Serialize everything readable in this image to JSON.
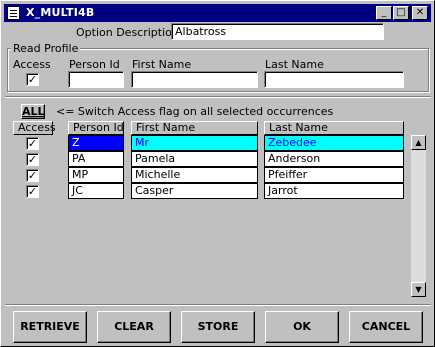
{
  "window": {
    "title": "X_MULTI4B",
    "minimize_glyph": "_",
    "maximize_glyph": "□",
    "close_glyph": "✕"
  },
  "option": {
    "label": "Option Description",
    "value": "Albatross"
  },
  "read_profile": {
    "legend": "Read Profile",
    "access_label": "Access",
    "person_id_label": "Person Id",
    "first_name_label": "First Name",
    "last_name_label": "Last Name",
    "access_checked": true,
    "person_id": "",
    "first_name": "",
    "last_name": ""
  },
  "switch": {
    "all_button": "ALL",
    "hint": "<= Switch Access flag on all selected occurrences"
  },
  "grid": {
    "headers": {
      "access": "Access",
      "person_id": "Person Id",
      "first_name": "First Name",
      "last_name": "Last Name"
    },
    "rows": [
      {
        "access": true,
        "person_id": "Z",
        "first_name": "Mr",
        "last_name": "Zebedee",
        "selected": true
      },
      {
        "access": true,
        "person_id": "PA",
        "first_name": "Pamela",
        "last_name": "Anderson",
        "selected": false
      },
      {
        "access": true,
        "person_id": "MP",
        "first_name": "Michelle",
        "last_name": "Pfeiffer",
        "selected": false
      },
      {
        "access": true,
        "person_id": "JC",
        "first_name": "Casper",
        "last_name": "Jarrot",
        "selected": false
      }
    ],
    "check_glyph": "✓",
    "selected_id_color": "#0000ff",
    "selected_row_color": "#00ffff"
  },
  "scrollbar": {
    "up_glyph": "▲",
    "down_glyph": "▼"
  },
  "buttons": {
    "retrieve": "RETRIEVE",
    "clear": "CLEAR",
    "store": "STORE",
    "ok": "OK",
    "cancel": "CANCEL"
  }
}
